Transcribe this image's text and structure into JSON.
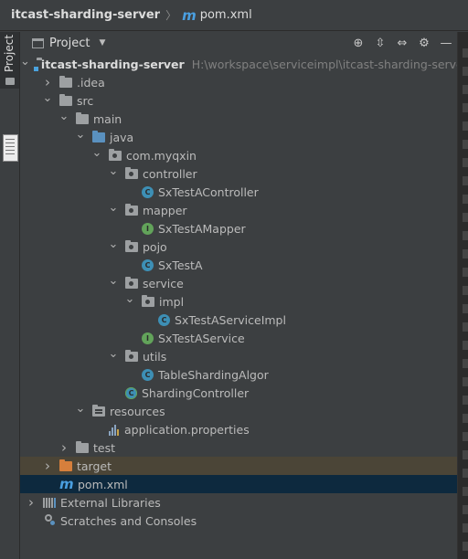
{
  "breadcrumb": {
    "project": "itcast-sharding-server",
    "file": "pom.xml",
    "file_badge": "m"
  },
  "toolstrip": {
    "project_tab_label": "Project"
  },
  "panel": {
    "title": "Project",
    "header_icons": [
      "crosshair-icon",
      "expand-all-icon",
      "collapse-all-icon",
      "gear-icon",
      "minimize-icon"
    ]
  },
  "tree": [
    {
      "label": "itcast-sharding-server",
      "path": "H:\\workspace\\serviceimpl\\itcast-sharding-server",
      "depth": 0,
      "arrow": "expanded",
      "icon": "module-folder-icon",
      "bold": true
    },
    {
      "label": ".idea",
      "depth": 1,
      "arrow": "collapsed",
      "icon": "folder-icon"
    },
    {
      "label": "src",
      "depth": 1,
      "arrow": "expanded",
      "icon": "folder-icon"
    },
    {
      "label": "main",
      "depth": 2,
      "arrow": "expanded",
      "icon": "folder-icon"
    },
    {
      "label": "java",
      "depth": 3,
      "arrow": "expanded",
      "icon": "source-folder-icon"
    },
    {
      "label": "com.myqxin",
      "depth": 4,
      "arrow": "expanded",
      "icon": "package-icon"
    },
    {
      "label": "controller",
      "depth": 5,
      "arrow": "expanded",
      "icon": "package-icon"
    },
    {
      "label": "SxTestAController",
      "depth": 6,
      "arrow": "none",
      "icon": "class-icon"
    },
    {
      "label": "mapper",
      "depth": 5,
      "arrow": "expanded",
      "icon": "package-icon"
    },
    {
      "label": "SxTestAMapper",
      "depth": 6,
      "arrow": "none",
      "icon": "interface-icon"
    },
    {
      "label": "pojo",
      "depth": 5,
      "arrow": "expanded",
      "icon": "package-icon"
    },
    {
      "label": "SxTestA",
      "depth": 6,
      "arrow": "none",
      "icon": "class-icon"
    },
    {
      "label": "service",
      "depth": 5,
      "arrow": "expanded",
      "icon": "package-icon"
    },
    {
      "label": "impl",
      "depth": 6,
      "arrow": "expanded",
      "icon": "package-icon"
    },
    {
      "label": "SxTestAServiceImpl",
      "depth": 7,
      "arrow": "none",
      "icon": "class-icon"
    },
    {
      "label": "SxTestAService",
      "depth": 6,
      "arrow": "none",
      "icon": "interface-icon"
    },
    {
      "label": "utils",
      "depth": 5,
      "arrow": "expanded",
      "icon": "package-icon"
    },
    {
      "label": "TableShardingAlgor",
      "depth": 6,
      "arrow": "none",
      "icon": "class-icon"
    },
    {
      "label": "ShardingController",
      "depth": 5,
      "arrow": "none",
      "icon": "spring-class-icon"
    },
    {
      "label": "resources",
      "depth": 3,
      "arrow": "expanded",
      "icon": "resources-folder-icon"
    },
    {
      "label": "application.properties",
      "depth": 4,
      "arrow": "none",
      "icon": "properties-file-icon"
    },
    {
      "label": "test",
      "depth": 2,
      "arrow": "collapsed",
      "icon": "folder-icon"
    },
    {
      "label": "target",
      "depth": 1,
      "arrow": "collapsed",
      "icon": "excluded-folder-icon",
      "highlight": "brown"
    },
    {
      "label": "pom.xml",
      "depth": 1,
      "arrow": "none",
      "icon": "maven-file-icon",
      "highlight": "blue"
    },
    {
      "label": "External Libraries",
      "depth": 0,
      "arrow": "collapsed",
      "icon": "library-icon"
    },
    {
      "label": "Scratches and Consoles",
      "depth": 0,
      "arrow": "none",
      "icon": "scratches-icon"
    }
  ]
}
